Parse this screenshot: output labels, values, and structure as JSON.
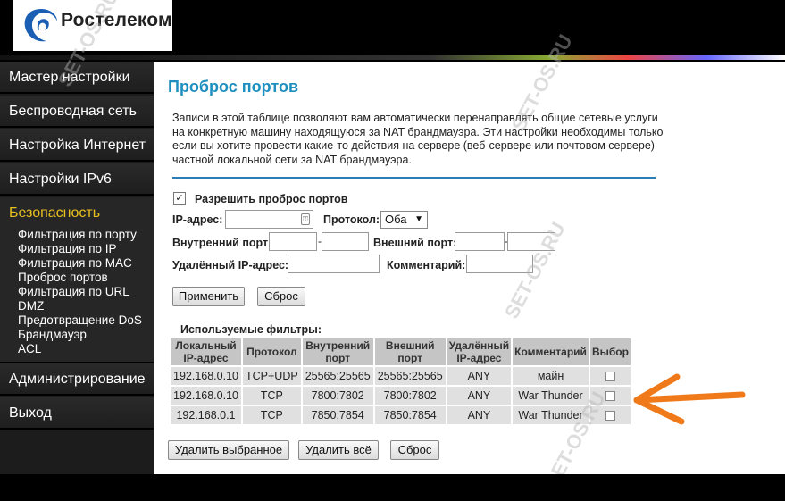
{
  "brand": {
    "name": "Ростелеком"
  },
  "sidebar": {
    "items": [
      {
        "label": "Мастер настройки"
      },
      {
        "label": "Беспроводная сеть"
      },
      {
        "label": "Настройка Интернет"
      },
      {
        "label": "Настройки IPv6"
      },
      {
        "label": "Безопасность"
      },
      {
        "label": "Администрирование"
      },
      {
        "label": "Выход"
      }
    ],
    "security_sub": [
      {
        "label": "Фильтрация по порту"
      },
      {
        "label": "Фильтрация по IP"
      },
      {
        "label": "Фильтрация по MAC"
      },
      {
        "label": "Проброс портов"
      },
      {
        "label": "Фильтрация по URL"
      },
      {
        "label": "DMZ"
      },
      {
        "label": "Предотвращение DoS"
      },
      {
        "label": "Брандмауэр"
      },
      {
        "label": "ACL"
      }
    ]
  },
  "main": {
    "title": "Проброс портов",
    "description": "Записи в этой таблице позволяют вам автоматически перенаправлять общие сетевые услуги на конкретную машину находящуюся за NAT брандмауэра. Эти настройки необходимы только если вы хотите провести какие-то действия на сервере (веб-сервере или почтовом сервере) частной локальной сети за NAT брандмауэра.",
    "form": {
      "enable_label": "Разрешить проброс портов",
      "enable_checked": "✓",
      "ip_label": "IP-адрес:",
      "protocol_label": "Протокол:",
      "protocol_value": "Оба",
      "internal_port_label": "Внутренний порт:",
      "external_port_label": "Внешний порт:",
      "remote_ip_label": "Удалённый IP-адрес:",
      "comment_label": "Комментарий:",
      "apply_button": "Применить",
      "reset_button": "Сброс"
    },
    "filters": {
      "title": "Используемые фильтры:",
      "headers": [
        "Локальный IP-адрес",
        "Протокол",
        "Внутренний порт",
        "Внешний порт",
        "Удалённый IP-адрес",
        "Комментарий",
        "Выбор"
      ],
      "rows": [
        {
          "local_ip": "192.168.0.10",
          "protocol": "TCP+UDP",
          "internal": "25565:25565",
          "external": "25565:25565",
          "remote": "ANY",
          "comment": "майн"
        },
        {
          "local_ip": "192.168.0.10",
          "protocol": "TCP",
          "internal": "7800:7802",
          "external": "7800:7802",
          "remote": "ANY",
          "comment": "War Thunder"
        },
        {
          "local_ip": "192.168.0.1",
          "protocol": "TCP",
          "internal": "7850:7854",
          "external": "7850:7854",
          "remote": "ANY",
          "comment": "War Thunder"
        }
      ],
      "delete_selected_button": "Удалить выбранное",
      "delete_all_button": "Удалить всё",
      "reset_button": "Сброс"
    }
  },
  "watermark": "SET-OS.RU",
  "colors": {
    "title": "#1f8fbf",
    "active_menu": "#e8c020",
    "arrow": "#f07a1a",
    "divider": "#2a7db5"
  }
}
